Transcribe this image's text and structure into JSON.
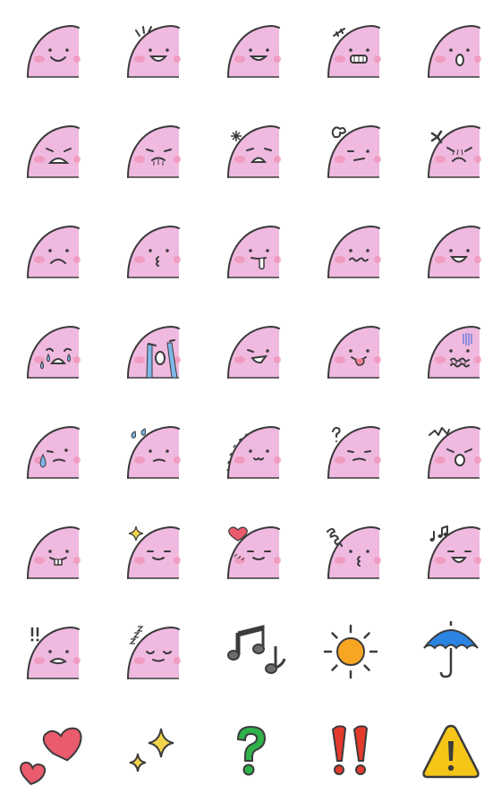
{
  "sheet": {
    "columns": 5,
    "rows": 8,
    "colors": {
      "blob": "#f0b9e0",
      "outline": "#3a3a3a",
      "cheek": "#f08fb2",
      "tear": "#7fb7e8",
      "heart": "#e95b6d",
      "sparkle": "#f3d54b",
      "umbrella": "#2b83e2",
      "sun": "#f6a623",
      "question": "#2fb24a",
      "exclamation": "#e43a2c",
      "warning": "#f5c518",
      "tongue": "#f27f91"
    },
    "items": [
      {
        "kind": "blob",
        "expression": "smile"
      },
      {
        "kind": "blob",
        "expression": "grin-sparkle"
      },
      {
        "kind": "blob",
        "expression": "smile-open"
      },
      {
        "kind": "blob",
        "expression": "grin-teeth"
      },
      {
        "kind": "blob",
        "expression": "surprised"
      },
      {
        "kind": "blob",
        "expression": "shocked-frown"
      },
      {
        "kind": "blob",
        "expression": "pout-lines"
      },
      {
        "kind": "blob",
        "expression": "worried-spark"
      },
      {
        "kind": "blob",
        "expression": "annoyed-puff"
      },
      {
        "kind": "blob",
        "expression": "angry-vein"
      },
      {
        "kind": "blob",
        "expression": "sad"
      },
      {
        "kind": "blob",
        "expression": "kiss"
      },
      {
        "kind": "blob",
        "expression": "drool"
      },
      {
        "kind": "blob",
        "expression": "wavy-mouth"
      },
      {
        "kind": "blob",
        "expression": "happy-open"
      },
      {
        "kind": "blob",
        "expression": "crying"
      },
      {
        "kind": "blob",
        "expression": "sobbing"
      },
      {
        "kind": "blob",
        "expression": "smirk-teeth"
      },
      {
        "kind": "blob",
        "expression": "tongue-out"
      },
      {
        "kind": "blob",
        "expression": "gloom"
      },
      {
        "kind": "blob",
        "expression": "sweat"
      },
      {
        "kind": "blob",
        "expression": "sweat-drops"
      },
      {
        "kind": "blob",
        "expression": "peek-dots"
      },
      {
        "kind": "blob",
        "expression": "question"
      },
      {
        "kind": "blob",
        "expression": "startled"
      },
      {
        "kind": "blob",
        "expression": "buck-teeth"
      },
      {
        "kind": "blob",
        "expression": "sparkle-smile"
      },
      {
        "kind": "blob",
        "expression": "heart-blush"
      },
      {
        "kind": "blob",
        "expression": "scribble-kiss"
      },
      {
        "kind": "blob",
        "expression": "music-smile"
      },
      {
        "kind": "blob",
        "expression": "exclaim"
      },
      {
        "kind": "blob",
        "expression": "sleepy"
      },
      {
        "kind": "icon",
        "icon": "music-notes-icon"
      },
      {
        "kind": "icon",
        "icon": "sun-icon"
      },
      {
        "kind": "icon",
        "icon": "umbrella-icon"
      },
      {
        "kind": "icon",
        "icon": "hearts-icon"
      },
      {
        "kind": "icon",
        "icon": "sparkles-icon"
      },
      {
        "kind": "icon",
        "icon": "question-mark-icon"
      },
      {
        "kind": "icon",
        "icon": "double-exclamation-icon"
      },
      {
        "kind": "icon",
        "icon": "warning-icon"
      }
    ]
  }
}
